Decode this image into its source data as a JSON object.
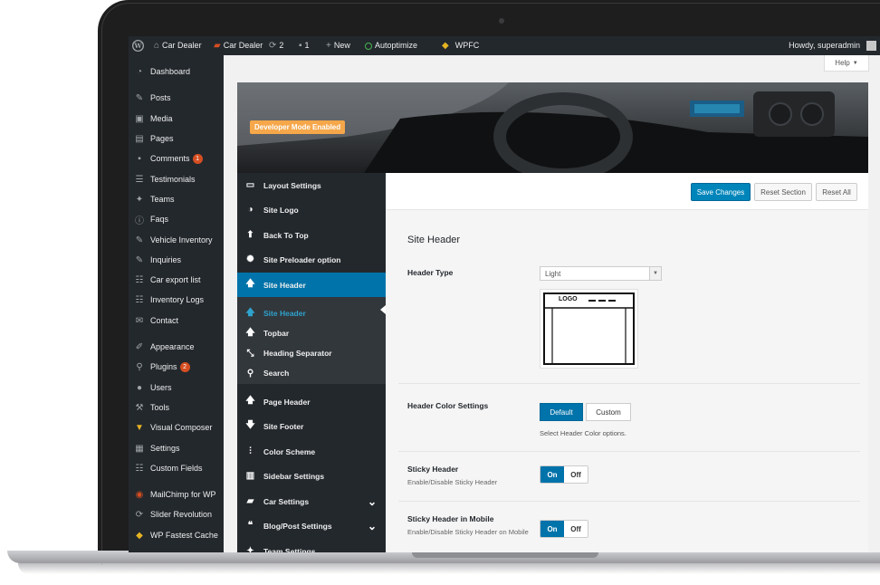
{
  "adminbar": {
    "items": [
      {
        "icon": "wordpress-icon",
        "label": ""
      },
      {
        "icon": "home-icon",
        "label": "Car Dealer"
      },
      {
        "icon": "car-icon",
        "label": "Car Dealer"
      },
      {
        "icon": "updates-icon",
        "label": "2"
      },
      {
        "icon": "comment-icon",
        "label": "1"
      },
      {
        "icon": "plus-icon",
        "label": "New"
      },
      {
        "icon": "status-dot-icon",
        "label": "Autoptimize"
      },
      {
        "icon": "wpfc-icon",
        "label": "WPFC"
      }
    ],
    "howdy": "Howdy, superadmin"
  },
  "help_tab": {
    "label": "Help"
  },
  "sidebar": {
    "items": [
      {
        "label": "Dashboard",
        "icon": "dashboard-icon"
      },
      {
        "label": "Posts",
        "icon": "pin-icon"
      },
      {
        "label": "Media",
        "icon": "media-icon"
      },
      {
        "label": "Pages",
        "icon": "pages-icon"
      },
      {
        "label": "Comments",
        "icon": "comments-icon",
        "badge": "1"
      },
      {
        "label": "Testimonials",
        "icon": "testimonial-icon"
      },
      {
        "label": "Teams",
        "icon": "teams-icon"
      },
      {
        "label": "Faqs",
        "icon": "info-icon"
      },
      {
        "label": "Vehicle Inventory",
        "icon": "pin-icon"
      },
      {
        "label": "Inquiries",
        "icon": "pin-icon"
      },
      {
        "label": "Car export list",
        "icon": "list-icon"
      },
      {
        "label": "Inventory Logs",
        "icon": "list-icon"
      },
      {
        "label": "Contact",
        "icon": "mail-icon"
      },
      {
        "label": "Appearance",
        "icon": "brush-icon"
      },
      {
        "label": "Plugins",
        "icon": "plugin-icon",
        "badge": "2"
      },
      {
        "label": "Users",
        "icon": "user-icon"
      },
      {
        "label": "Tools",
        "icon": "wrench-icon"
      },
      {
        "label": "Visual Composer",
        "icon": "vc-icon"
      },
      {
        "label": "Settings",
        "icon": "settings-icon"
      },
      {
        "label": "Custom Fields",
        "icon": "fields-icon"
      },
      {
        "label": "MailChimp for WP",
        "icon": "mailchimp-icon"
      },
      {
        "label": "Slider Revolution",
        "icon": "refresh-icon"
      },
      {
        "label": "WP Fastest Cache",
        "icon": "cheetah-icon"
      }
    ]
  },
  "banner": {
    "dev_badge": "Developer Mode Enabled"
  },
  "options_nav": {
    "items": [
      {
        "label": "Layout Settings",
        "icon": "layout-icon"
      },
      {
        "label": "Site Logo",
        "icon": "logo-icon"
      },
      {
        "label": "Back To Top",
        "icon": "up-circle-icon"
      },
      {
        "label": "Site Preloader option",
        "icon": "spinner-icon"
      },
      {
        "label": "Site Header",
        "icon": "arrow-up-icon"
      }
    ],
    "sub_items": [
      {
        "label": "Site Header",
        "icon": "arrow-up-icon"
      },
      {
        "label": "Topbar",
        "icon": "arrow-up-icon"
      },
      {
        "label": "Heading Separator",
        "icon": "compress-icon"
      },
      {
        "label": "Search",
        "icon": "search-icon"
      }
    ],
    "more_items": [
      {
        "label": "Page Header",
        "icon": "arrow-up-icon"
      },
      {
        "label": "Site Footer",
        "icon": "arrow-down-icon"
      },
      {
        "label": "Color Scheme",
        "icon": "sliders-icon"
      },
      {
        "label": "Sidebar Settings",
        "icon": "columns-icon"
      },
      {
        "label": "Car Settings",
        "icon": "car-icon"
      },
      {
        "label": "Blog/Post Settings",
        "icon": "quote-icon"
      },
      {
        "label": "Team Settings",
        "icon": "team-icon"
      }
    ]
  },
  "toolbar": {
    "save": "Save Changes",
    "reset_section": "Reset Section",
    "reset_all": "Reset All"
  },
  "main": {
    "section_title": "Site Header",
    "header_type": {
      "label": "Header Type",
      "value": "Light",
      "preview_logo": "LOGO"
    },
    "header_color": {
      "label": "Header Color Settings",
      "options": [
        "Default",
        "Custom"
      ],
      "selected": "Default",
      "note": "Select Header Color options."
    },
    "sticky": {
      "label": "Sticky Header",
      "desc": "Enable/Disable Sticky Header",
      "on": "On",
      "off": "Off"
    },
    "sticky_mobile": {
      "label": "Sticky Header in Mobile",
      "desc": "Enable/Disable Sticky Header on Mobile",
      "on": "On",
      "off": "Off"
    }
  },
  "colors": {
    "adminbar": "#23282d",
    "accent": "#0073aa",
    "badge": "#d54e21",
    "dev_badge": "#f5a74a"
  }
}
